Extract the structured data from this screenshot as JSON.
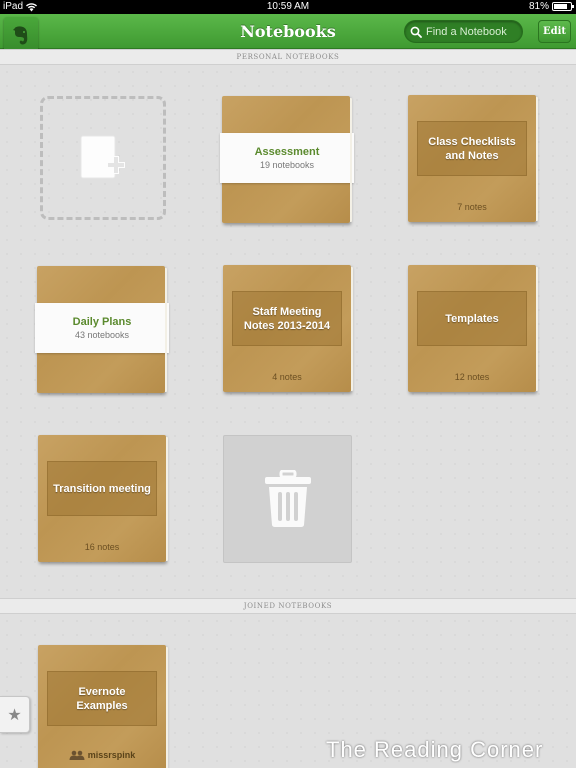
{
  "status_bar": {
    "device": "iPad",
    "time": "10:59 AM",
    "battery": "81%",
    "battery_level": 0.81
  },
  "header": {
    "title": "Notebooks",
    "search_placeholder": "Find a Notebook",
    "edit_label": "Edit",
    "logo_icon": "evernote-elephant-icon"
  },
  "sections": {
    "personal": "PERSONAL NOTEBOOKS",
    "joined": "JOINED NOTEBOOKS"
  },
  "personal_notebooks": [
    {
      "type": "new",
      "icon": "new-notebook-icon"
    },
    {
      "type": "stack",
      "name": "Assessment",
      "count": "19 notebooks"
    },
    {
      "type": "notebook",
      "name": "Class Checklists and Notes",
      "count": "7 notes"
    },
    {
      "type": "stack",
      "name": "Daily Plans",
      "count": "43 notebooks"
    },
    {
      "type": "notebook",
      "name": "Staff Meeting Notes 2013-2014",
      "count": "4 notes"
    },
    {
      "type": "notebook",
      "name": "Templates",
      "count": "12 notes"
    },
    {
      "type": "notebook",
      "name": "Transition meeting",
      "count": "16 notes"
    },
    {
      "type": "trash",
      "icon": "trash-icon"
    }
  ],
  "joined_notebooks": [
    {
      "type": "shared",
      "name": "Evernote Examples",
      "owner": "missrspink",
      "icon": "shared-people-icon"
    }
  ],
  "shortcuts_icon": "star-icon",
  "watermark": "The Reading Corner",
  "colors": {
    "accent_green": "#4aa83b",
    "notebook_tan": "#c39c5a",
    "stack_title_green": "#5b8a2e"
  }
}
